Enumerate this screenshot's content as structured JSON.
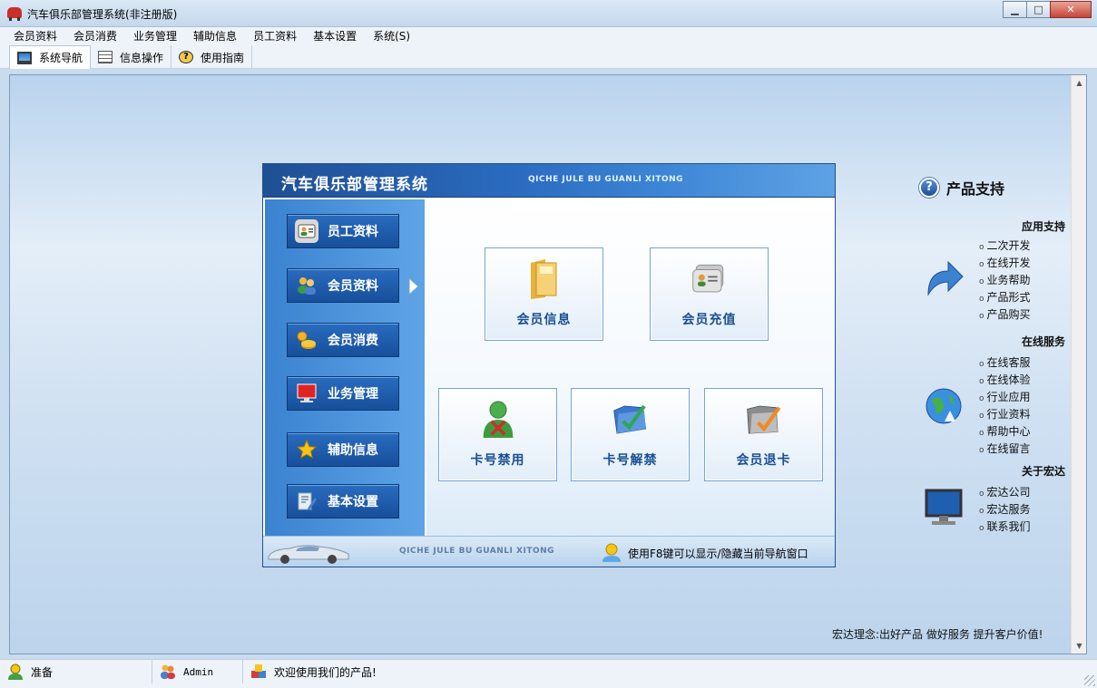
{
  "window": {
    "title": "汽车俱乐部管理系统(非注册版)"
  },
  "menu": [
    "会员资料",
    "会员消费",
    "业务管理",
    "辅助信息",
    "员工资料",
    "基本设置",
    "系统(S)"
  ],
  "toolbar": {
    "nav": "系统导航",
    "info": "信息操作",
    "guide": "使用指南"
  },
  "nav": {
    "title": "汽车俱乐部管理系统",
    "subtitle": "QICHE JULE BU GUANLI XITONG",
    "side": [
      "员工资料",
      "会员资料",
      "会员消费",
      "业务管理",
      "辅助信息",
      "基本设置"
    ],
    "tiles": [
      "会员信息",
      "会员充值",
      "卡号禁用",
      "卡号解禁",
      "会员退卡"
    ],
    "footer_sub": "QICHE JULE BU GUANLI XITONG",
    "footer_tip": "使用F8键可以显示/隐藏当前导航窗口"
  },
  "support": {
    "title": "产品支持",
    "app": {
      "head": "应用支持",
      "items": [
        "二次开发",
        "在线开发",
        "业务帮助",
        "产品形式",
        "产品购买"
      ]
    },
    "online": {
      "head": "在线服务",
      "items": [
        "在线客服",
        "在线体验",
        "行业应用",
        "行业资料",
        "帮助中心",
        "在线留言"
      ]
    },
    "about": {
      "head": "关于宏达",
      "items": [
        "宏达公司",
        "宏达服务",
        "联系我们"
      ]
    },
    "slogan": "宏达理念:出好产品 做好服务 提升客户价值!"
  },
  "status": {
    "ready": "准备",
    "user": "Admin",
    "welcome": "欢迎使用我们的产品!"
  },
  "colors": {
    "nav_header": "#2b6cc0",
    "side_button": "#174f9a",
    "tile_text": "#1a4f93"
  }
}
